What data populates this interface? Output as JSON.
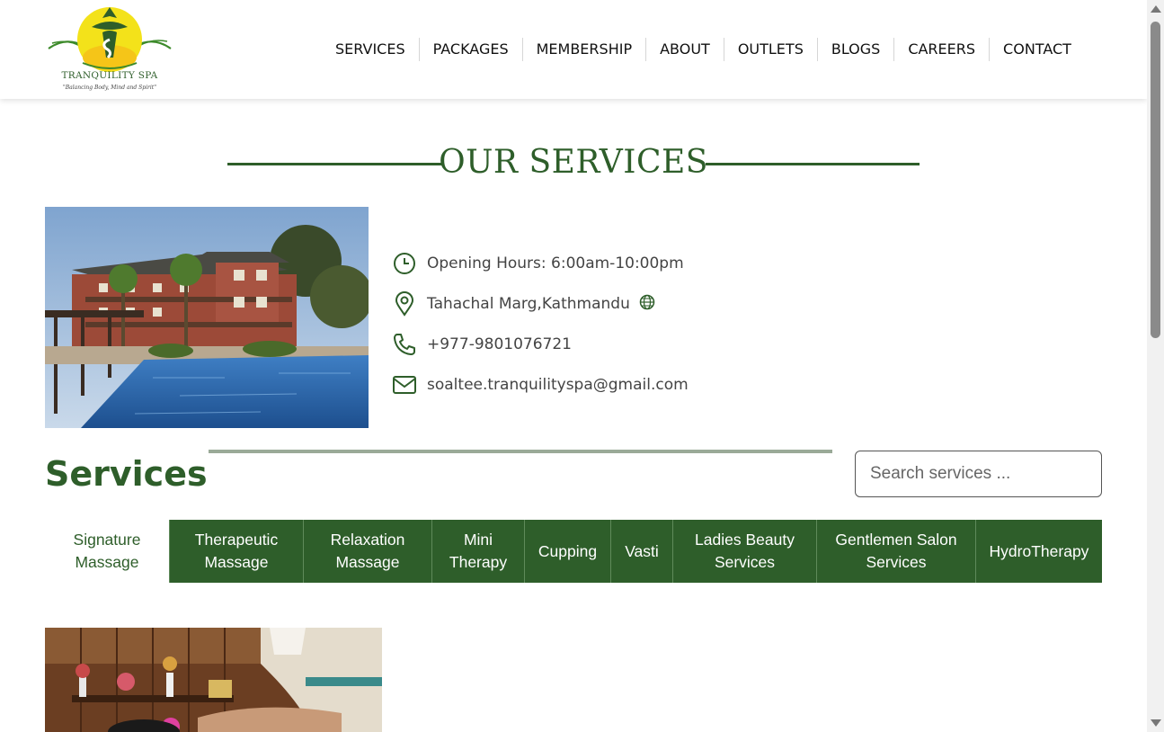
{
  "brand": {
    "name": "TRANQUILITY SPA",
    "tagline": "\"Balancing Body, Mind and Spirit\"",
    "primary_color": "#2e5e2a"
  },
  "nav": {
    "items": [
      "SERVICES",
      "PACKAGES",
      "MEMBERSHIP",
      "ABOUT",
      "OUTLETS",
      "BLOGS",
      "CAREERS",
      "CONTACT"
    ]
  },
  "hero": {
    "title": "OUR SERVICES"
  },
  "info": {
    "hours": "Opening Hours: 6:00am-10:00pm",
    "address": "Tahachal Marg,Kathmandu",
    "phone": "+977-9801076721",
    "email": "soaltee.tranquilityspa@gmail.com"
  },
  "services": {
    "heading": "Services",
    "search_placeholder": "Search services ...",
    "tabs": [
      {
        "label": "Signature Massage",
        "active": true
      },
      {
        "label": "Therapeutic Massage",
        "active": false
      },
      {
        "label": "Relaxation Massage",
        "active": false
      },
      {
        "label": "Mini Therapy",
        "active": false
      },
      {
        "label": "Cupping",
        "active": false
      },
      {
        "label": "Vasti",
        "active": false
      },
      {
        "label": "Ladies Beauty Services",
        "active": false
      },
      {
        "label": "Gentlemen Salon Services",
        "active": false
      },
      {
        "label": "HydroTherapy",
        "active": false
      }
    ]
  },
  "icons": {
    "hours": "clock-icon",
    "address": "map-pin-icon",
    "map_link": "globe-icon",
    "phone": "phone-icon",
    "email": "mail-icon"
  }
}
